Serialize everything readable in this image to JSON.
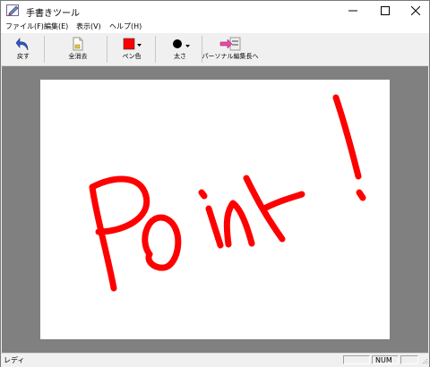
{
  "window": {
    "title": "手書きツール"
  },
  "menu": [
    "ファイル(F)",
    "編集(E)",
    "表示(V)",
    "ヘルプ(H)"
  ],
  "toolbar": {
    "undo_label": "戻す",
    "clear_label": "全消去",
    "pen_color_label": "ペン色",
    "thickness_label": "太さ",
    "export_label": "パーソナル編集長へ"
  },
  "colors": {
    "pen": "#ff0000",
    "canvas_bg": "#ffffff",
    "workspace": "#808080"
  },
  "canvas": {
    "drawn_text": "Point!"
  },
  "status": {
    "text": "レディ",
    "num": "NUM"
  }
}
